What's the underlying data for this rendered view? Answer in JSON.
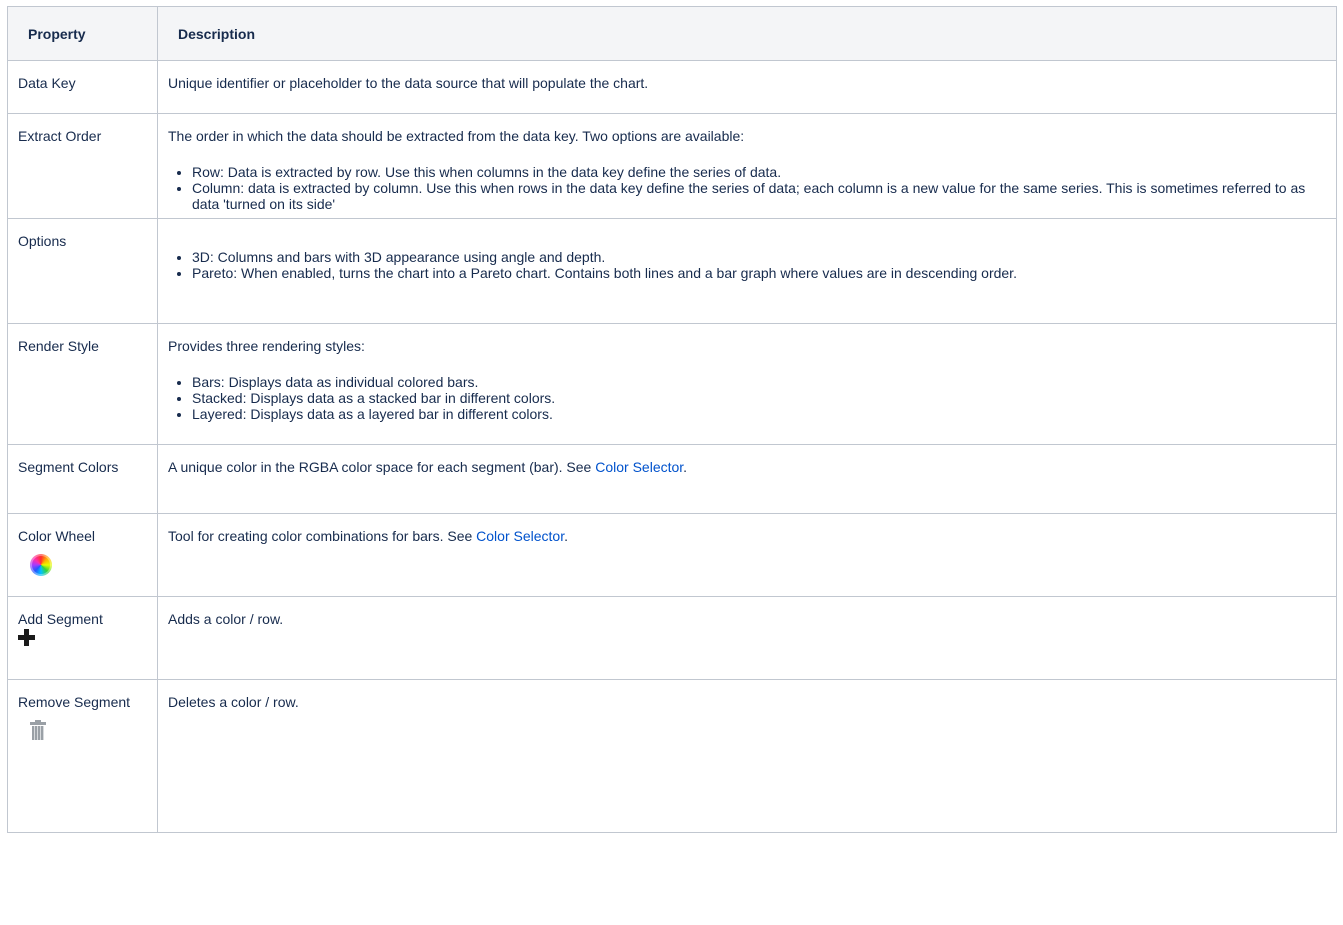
{
  "header": {
    "property": "Property",
    "description": "Description"
  },
  "rows": {
    "data_key": {
      "property": "Data Key",
      "description": "Unique identifier or placeholder to the data source that will populate the chart."
    },
    "extract_order": {
      "property": "Extract Order",
      "intro": "The order in which the data should be extracted from the data key. Two options are available:",
      "bullets": [
        "Row: Data is extracted by row. Use this when columns in the data key define the series of data.",
        "Column: data is extracted by column. Use this when rows in the data key define the series of data; each column is a new value for the same series. This is sometimes referred to as data 'turned on its side'"
      ]
    },
    "options": {
      "property": "Options",
      "bullets": [
        "3D: Columns and bars with 3D appearance using angle and depth.",
        "Pareto: When enabled, turns the chart into a Pareto chart. Contains both lines and a bar graph where values are in descending order."
      ]
    },
    "render_style": {
      "property": "Render Style",
      "intro": "Provides three rendering styles:",
      "bullets": [
        "Bars: Displays data as individual colored bars.",
        "Stacked: Displays data as a stacked bar in different colors.",
        "Layered: Displays data as a layered bar in different colors."
      ]
    },
    "segment_colors": {
      "property": "Segment Colors",
      "description": "A unique color in the RGBA color space for each segment (bar). See ",
      "link": "Color Selector",
      "trail": "."
    },
    "color_wheel": {
      "property": "Color Wheel",
      "icon": "color-wheel-icon",
      "description": "Tool for creating color combinations for bars. See ",
      "link": "Color Selector",
      "trail": "."
    },
    "add_segment": {
      "property": "Add Segment",
      "icon": "plus-icon",
      "description": "Adds a color / row."
    },
    "remove_segment": {
      "property": "Remove Segment",
      "icon": "trash-icon",
      "description": "Deletes a color / row."
    }
  },
  "colors": {
    "header_bg": "#f4f5f7",
    "border": "#c1c7d0",
    "link": "#0052cc",
    "text": "#172b4d"
  }
}
